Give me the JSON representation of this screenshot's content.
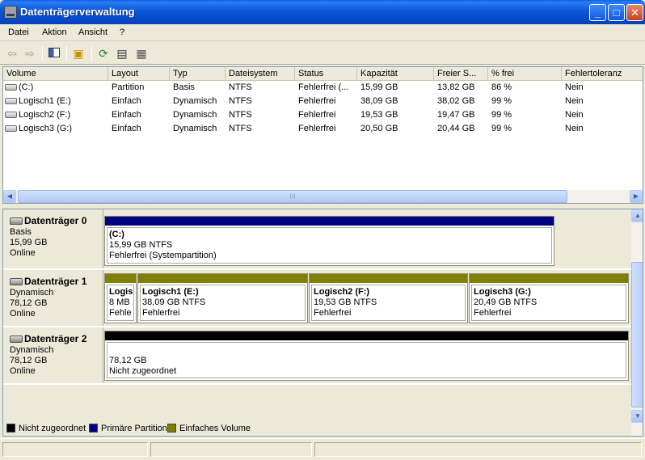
{
  "window": {
    "title": "Datenträgerverwaltung"
  },
  "menu": [
    "Datei",
    "Aktion",
    "Ansicht",
    "?"
  ],
  "toolbar": {
    "icons": [
      "back-icon",
      "forward-icon",
      "console-tree-icon",
      "help-icon",
      "refresh-icon",
      "properties-icon",
      "help-topic-icon"
    ]
  },
  "list": {
    "columns": [
      "Volume",
      "Layout",
      "Typ",
      "Dateisystem",
      "Status",
      "Kapazität",
      "Freier S...",
      "% frei",
      "Fehlertoleranz"
    ],
    "rows": [
      [
        "(C:)",
        "Partition",
        "Basis",
        "NTFS",
        "Fehlerfrei (...",
        "15,99 GB",
        "13,82 GB",
        "86 %",
        "Nein"
      ],
      [
        "Logisch1 (E:)",
        "Einfach",
        "Dynamisch",
        "NTFS",
        "Fehlerfrei",
        "38,09 GB",
        "38,02 GB",
        "99 %",
        "Nein"
      ],
      [
        "Logisch2 (F:)",
        "Einfach",
        "Dynamisch",
        "NTFS",
        "Fehlerfrei",
        "19,53 GB",
        "19,47 GB",
        "99 %",
        "Nein"
      ],
      [
        "Logisch3 (G:)",
        "Einfach",
        "Dynamisch",
        "NTFS",
        "Fehlerfrei",
        "20,50 GB",
        "20,44 GB",
        "99 %",
        "Nein"
      ]
    ],
    "scroll_grip": "III"
  },
  "disks": [
    {
      "name": "Datenträger 0",
      "type": "Basis",
      "size": "15,99 GB",
      "state": "Online",
      "partitions": [
        {
          "label": "(C:)",
          "size": "15,99 GB NTFS",
          "status": "Fehlerfrei (Systempartition)",
          "color": "#000080"
        }
      ]
    },
    {
      "name": "Datenträger 1",
      "type": "Dynamisch",
      "size": "78,12 GB",
      "state": "Online",
      "partitions": [
        {
          "label": "Logis",
          "size": "8 MB",
          "status": "Fehle",
          "color": "#808000"
        },
        {
          "label": "Logisch1  (E:)",
          "size": "38,09 GB NTFS",
          "status": "Fehlerfrei",
          "color": "#808000"
        },
        {
          "label": "Logisch2  (F:)",
          "size": "19,53 GB NTFS",
          "status": "Fehlerfrei",
          "color": "#808000"
        },
        {
          "label": "Logisch3  (G:)",
          "size": "20,49 GB NTFS",
          "status": "Fehlerfrei",
          "color": "#808000"
        }
      ]
    },
    {
      "name": "Datenträger 2",
      "type": "Dynamisch",
      "size": "78,12 GB",
      "state": "Online",
      "partitions": [
        {
          "label": "",
          "size": "78,12 GB",
          "status": "Nicht zugeordnet",
          "color": "#000000"
        }
      ]
    }
  ],
  "legend": [
    {
      "label": "Nicht zugeordnet",
      "color": "#000000"
    },
    {
      "label": "Primäre Partition",
      "color": "#000080"
    },
    {
      "label": "Einfaches Volume",
      "color": "#808000"
    }
  ]
}
